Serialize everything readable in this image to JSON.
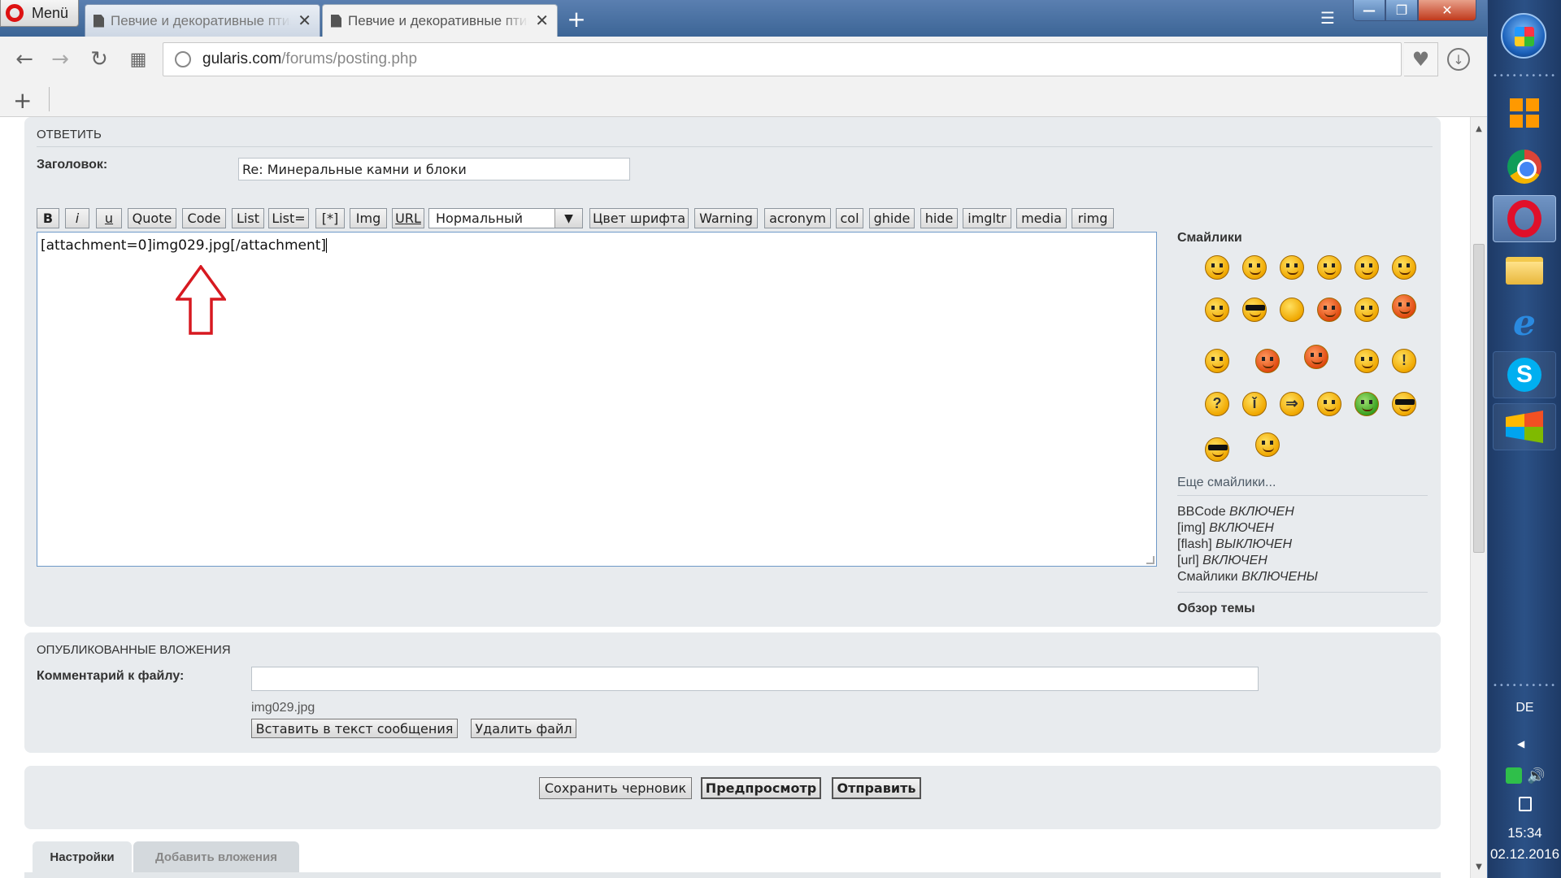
{
  "browser": {
    "menu_label": "Menü",
    "tabs": [
      {
        "title": "Певчие и декоративные птицы",
        "active": false
      },
      {
        "title": "Певчие и декоративные птицы",
        "active": true
      }
    ],
    "new_tab": "+",
    "url_host": "gularis.com",
    "url_path": "/forums/posting.php",
    "speeddial_add": "+"
  },
  "reply": {
    "header": "ОТВЕТИТЬ",
    "subject_label": "Заголовок:",
    "subject_value": "Re: Минеральные камни и блоки",
    "toolbar": [
      "B",
      "i",
      "u",
      "Quote",
      "Code",
      "List",
      "List=",
      "[*]",
      "Img",
      "URL"
    ],
    "font_size_selected": "Нормальный",
    "toolbar_after": [
      "Цвет шрифта",
      "Warning",
      "acronym",
      "col",
      "ghide",
      "hide",
      "imgltr",
      "media",
      "rimg"
    ],
    "message_text": "[attachment=0]img029.jpg[/attachment]"
  },
  "sidebar": {
    "smilies_title": "Смайлики",
    "more_smilies": "Еще смайлики...",
    "status": [
      {
        "label": "BBCode",
        "state": "ВКЛЮЧЕН"
      },
      {
        "label": "[img]",
        "state": "ВКЛЮЧЕН"
      },
      {
        "label": "[flash]",
        "state": "ВЫКЛЮЧЕН"
      },
      {
        "label": "[url]",
        "state": "ВКЛЮЧЕН"
      },
      {
        "label": "Смайлики",
        "state": "ВКЛЮЧЕНЫ"
      }
    ],
    "topic_review": "Обзор темы"
  },
  "attachments": {
    "header": "ОПУБЛИКОВАННЫЕ ВЛОЖЕНИЯ",
    "comment_label": "Комментарий к файлу:",
    "comment_value": "",
    "filename": "img029.jpg",
    "insert_button": "Вставить в текст сообщения",
    "delete_button": "Удалить файл"
  },
  "actions": {
    "save_draft": "Сохранить черновик",
    "preview": "Предпросмотр",
    "submit": "Отправить"
  },
  "bottom_tabs": {
    "settings": "Настройки",
    "add_attachments": "Добавить вложения"
  },
  "taskbar": {
    "language": "DE",
    "time": "15:34",
    "date": "02.12.2016"
  },
  "colors": {
    "panel_bg": "#e8ebee",
    "editor_border": "#6f99c8",
    "arrow_red": "#d71920",
    "taskbar": "#2b5186"
  }
}
